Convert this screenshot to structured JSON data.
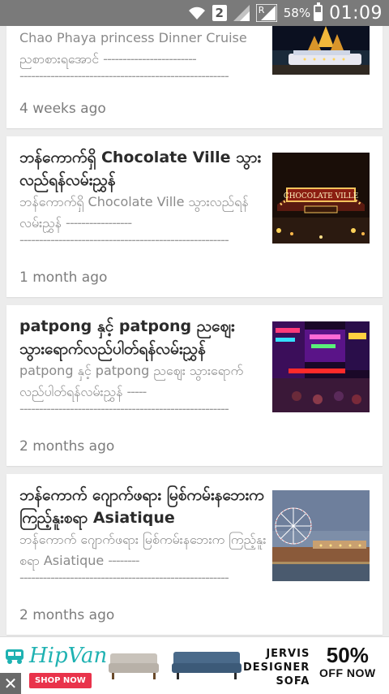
{
  "status_bar": {
    "sim_badge": "2",
    "battery_percent": "58%",
    "battery_level": 0.58,
    "time": "01:09",
    "network_badge": "R"
  },
  "posts": [
    {
      "title": "",
      "excerpt": "Chao Phaya princess Dinner Cruise ညစာစားရအောင်",
      "age": "4 weeks ago",
      "thumb_icon": "cruise-night-photo"
    },
    {
      "title": "ဘန်ကောက်ရှိ Chocolate Ville သွားလည်ရန်လမ်းညွှန်",
      "excerpt": "ဘန်ကောက်ရှိ Chocolate Ville သွားလည်ရန်လမ်းညွှန်",
      "age": "1 month ago",
      "thumb_icon": "chocolate-ville-photo"
    },
    {
      "title": "patpong နှင့် patpong ညဈေး သွားရောက်လည်ပါတ်ရန်လမ်းညွှန်",
      "excerpt": "patpong နှင့် patpong ညဈေး သွားရောက်လည်ပါတ်ရန်လမ်းညွှန်",
      "age": "2 months ago",
      "thumb_icon": "patpong-neon-photo"
    },
    {
      "title": "ဘန်ကောက် ဂျောက်ဖရား မြစ်ကမ်းနဘေးက ကြည့်နူးစရာ Asiatique",
      "excerpt": "ဘန်ကောက် ဂျောက်ဖရား မြစ်ကမ်းနဘေးက ကြည့်နူးစရာ Asiatique",
      "age": "2 months ago",
      "thumb_icon": "asiatique-ferris-wheel-photo"
    }
  ],
  "ad": {
    "brand": "HipVan",
    "cta": "SHOP NOW",
    "line1": "JERVIS",
    "line2": "DESIGNER",
    "line3": "SOFA",
    "discount": "50%",
    "discount_label": "OFF NOW",
    "close": "✕",
    "accent": "#1fb2b2",
    "cta_color": "#e9334b"
  }
}
